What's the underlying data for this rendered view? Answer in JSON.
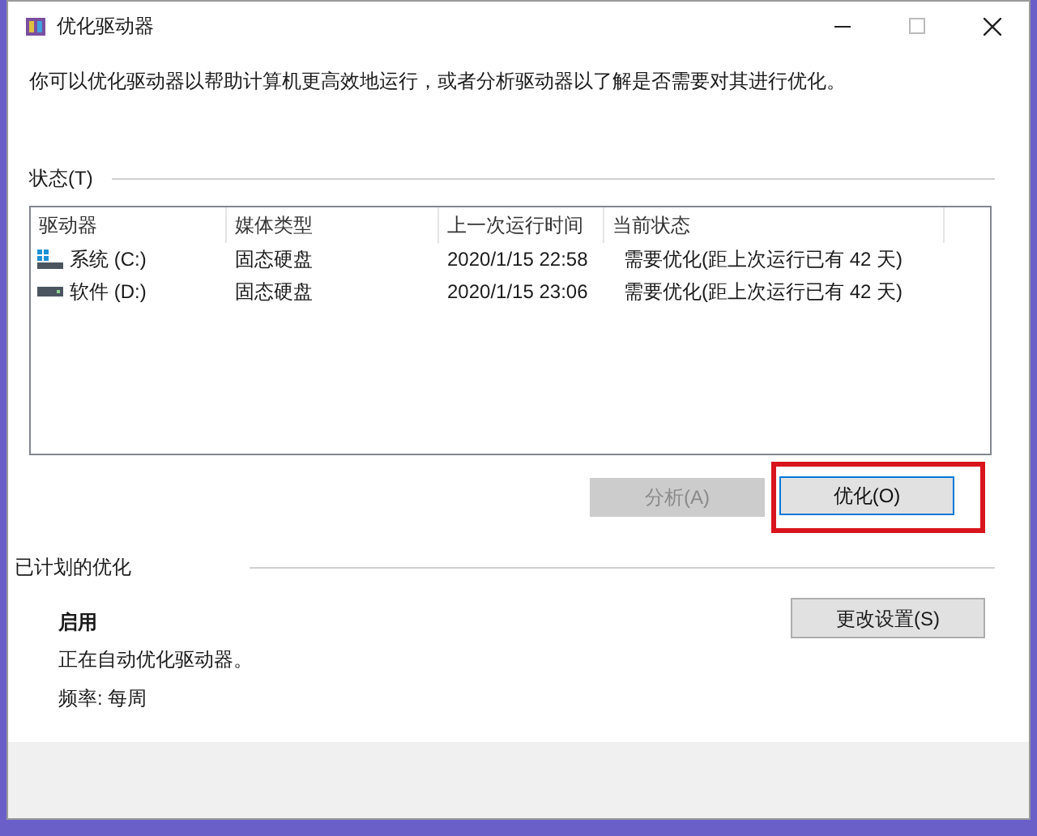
{
  "window": {
    "title": "优化驱动器"
  },
  "intro": "你可以优化驱动器以帮助计算机更高效地运行，或者分析驱动器以了解是否需要对其进行优化。",
  "status": {
    "label": "状态(T)",
    "columns": [
      "驱动器",
      "媒体类型",
      "上一次运行时间",
      "当前状态"
    ],
    "rows": [
      {
        "kind": "system",
        "drive": "系统 (C:)",
        "media": "固态硬盘",
        "last_run": "2020/1/15 22:58",
        "state": "需要优化(距上次运行已有 42 天)"
      },
      {
        "kind": "data",
        "drive": "软件 (D:)",
        "media": "固态硬盘",
        "last_run": "2020/1/15 23:06",
        "state": "需要优化(距上次运行已有 42 天)"
      }
    ],
    "buttons": [
      {
        "label": "分析(A)",
        "disabled": true,
        "highlighted": false
      },
      {
        "label": "优化(O)",
        "disabled": false,
        "highlighted": true
      }
    ]
  },
  "scheduled": {
    "label": "已计划的优化",
    "status": "启用",
    "description": "正在自动优化驱动器。",
    "frequency": "频率: 每周",
    "button": {
      "label": "更改设置(S)"
    }
  }
}
